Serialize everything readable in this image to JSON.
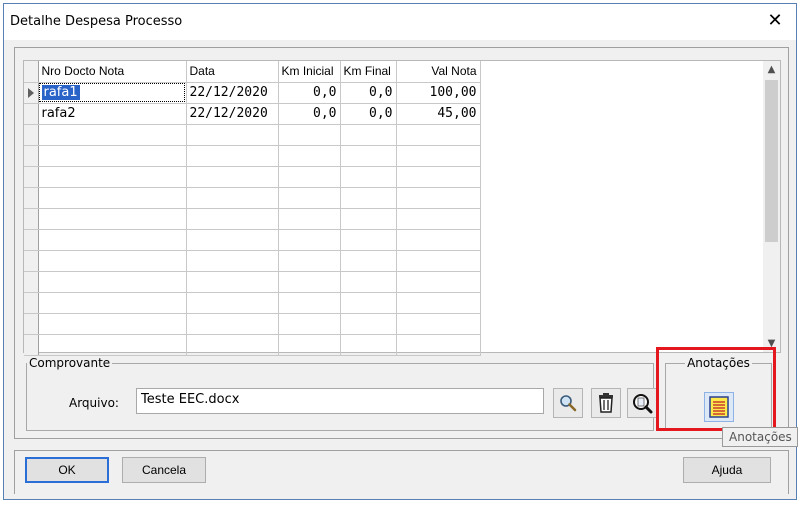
{
  "window": {
    "title": "Detalhe Despesa Processo",
    "close_glyph": "✕"
  },
  "grid": {
    "headers": [
      "Nro Docto Nota",
      "Data",
      "Km Inicial",
      "Km Final",
      "Val Nota"
    ],
    "rows": [
      {
        "doc": "rafa1",
        "data": "22/12/2020",
        "km_inicial": "0,0",
        "km_final": "0,0",
        "valor": "100,00"
      },
      {
        "doc": "rafa2",
        "data": "22/12/2020",
        "km_inicial": "0,0",
        "km_final": "0,0",
        "valor": "45,00"
      }
    ],
    "scroll_up_glyph": "▲",
    "scroll_down_glyph": "▼"
  },
  "comprovante": {
    "legend": "Comprovante",
    "arquivo_label": "Arquivo:",
    "arquivo_value": "Teste EEC.docx"
  },
  "anotacoes": {
    "legend": "Anotações",
    "tooltip": "Anotações"
  },
  "buttons": {
    "ok": "OK",
    "cancela": "Cancela",
    "ajuda": "Ajuda"
  },
  "icons": [
    "search-icon",
    "trash-icon",
    "zoom-icon",
    "notes-icon"
  ],
  "colors": {
    "selection": "#2a63c7",
    "highlight": "#e3171d"
  }
}
